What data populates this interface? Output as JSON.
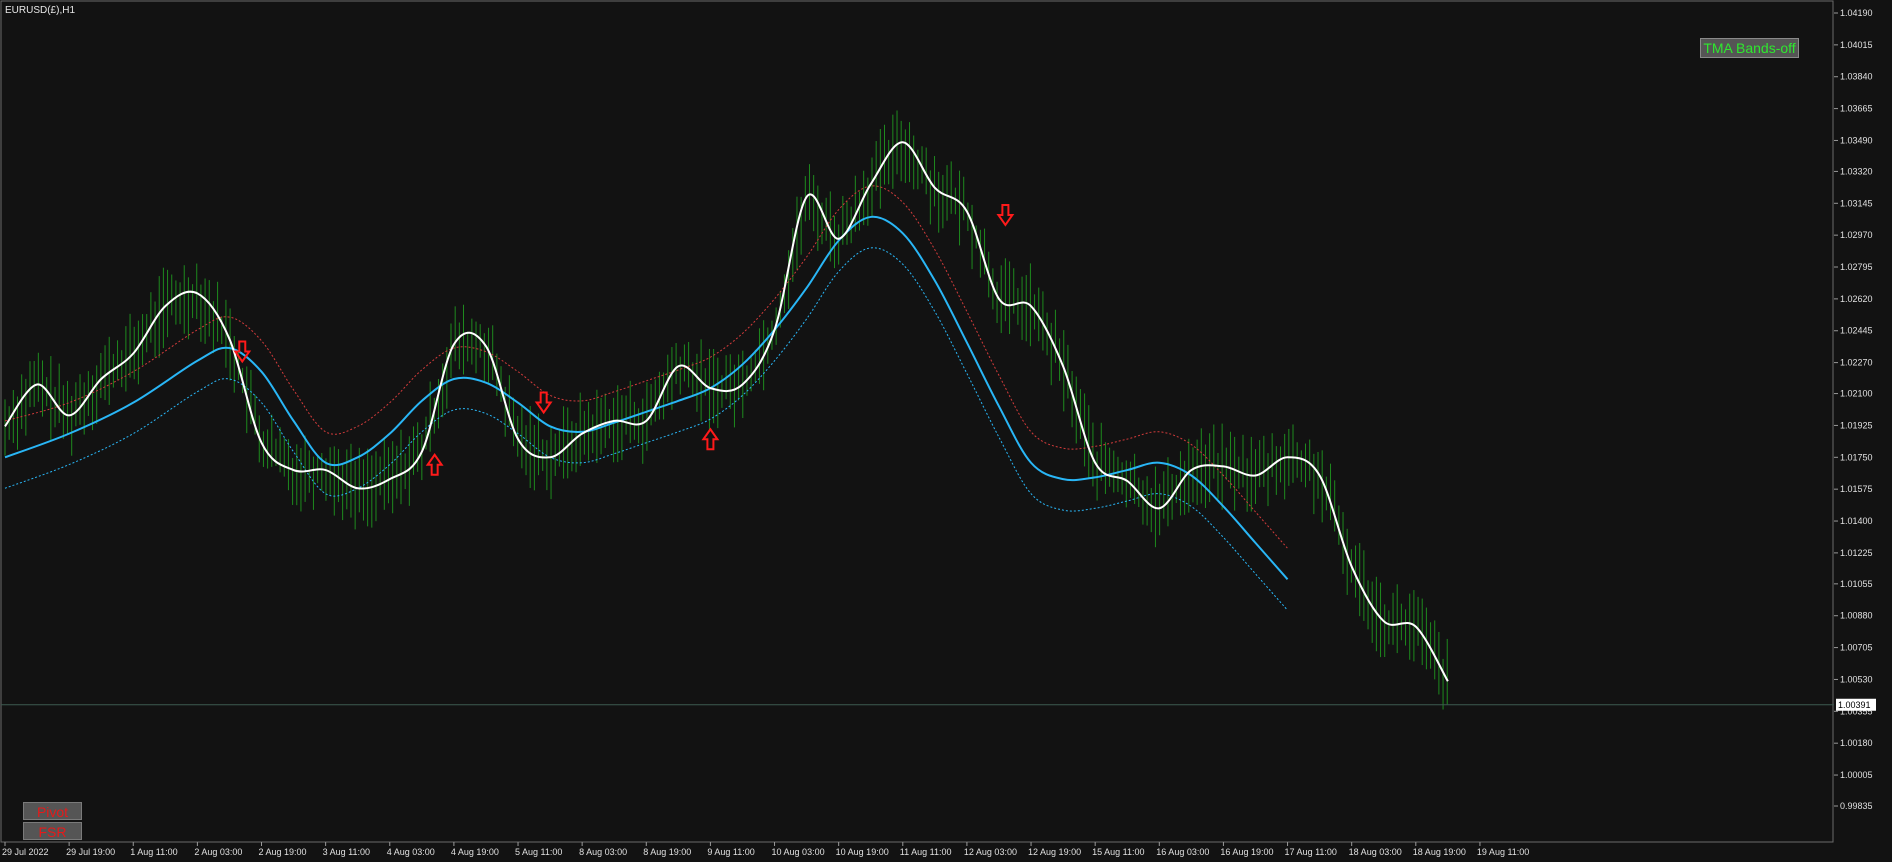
{
  "header": {
    "symbol_label": "EURUSD(£),H1"
  },
  "buttons": {
    "tma": "TMA Bands-off",
    "pivot": "Pivot",
    "fsr": "FSR"
  },
  "colors": {
    "background": "#121212",
    "axis": "#e0e0e0",
    "candles": "#1e8a1e",
    "price_line": "#ffffff",
    "tma_mid": "#29b6f6",
    "tma_mid_down": "#a89ab8",
    "upper_band": "#d23b3b",
    "lower_band": "#29b6f6",
    "signal": "#ff1a1a"
  },
  "chart_data": {
    "type": "line",
    "title": "EURUSD(£),H1",
    "ylim": [
      0.99835,
      1.0419
    ],
    "y_ticks": [
      "1.04190",
      "1.04015",
      "1.03840",
      "1.03665",
      "1.03490",
      "1.03320",
      "1.03145",
      "1.02970",
      "1.02795",
      "1.02620",
      "1.02445",
      "1.02270",
      "1.02100",
      "1.01925",
      "1.01750",
      "1.01575",
      "1.01400",
      "1.01225",
      "1.01055",
      "1.00880",
      "1.00705",
      "1.00530",
      "1.00355",
      "1.00180",
      "1.00005",
      "0.99835"
    ],
    "x_ticks": [
      "29 Jul 2022",
      "29 Jul 19:00",
      "1 Aug 11:00",
      "2 Aug 03:00",
      "2 Aug 19:00",
      "3 Aug 11:00",
      "4 Aug 03:00",
      "4 Aug 19:00",
      "5 Aug 11:00",
      "8 Aug 03:00",
      "8 Aug 19:00",
      "9 Aug 11:00",
      "10 Aug 03:00",
      "10 Aug 19:00",
      "11 Aug 11:00",
      "12 Aug 03:00",
      "12 Aug 19:00",
      "15 Aug 11:00",
      "16 Aug 03:00",
      "16 Aug 19:00",
      "17 Aug 11:00",
      "18 Aug 03:00",
      "18 Aug 19:00",
      "19 Aug 11:00"
    ],
    "current_price": "1.00391",
    "series": [
      {
        "key": "price",
        "x": [
          0,
          0.5,
          1,
          1.5,
          2,
          2.5,
          3,
          3.5,
          4,
          4.5,
          5,
          5.5,
          6,
          6.5,
          7,
          7.5,
          8,
          8.5,
          9,
          9.5,
          10,
          10.5,
          11,
          11.5,
          12,
          12.5,
          13,
          13.5,
          14,
          14.5,
          15,
          15.5,
          16,
          16.5,
          17,
          17.5,
          18,
          18.5,
          19,
          19.5,
          20,
          20.5,
          21,
          21.5,
          22,
          22.5,
          23,
          23.5
        ],
        "values": [
          1.0192,
          1.0215,
          1.0198,
          1.0218,
          1.0232,
          1.0258,
          1.0265,
          1.024,
          1.0183,
          1.0168,
          1.0168,
          1.0158,
          1.0163,
          1.0178,
          1.0237,
          1.0236,
          1.0185,
          1.0175,
          1.0188,
          1.0195,
          1.0195,
          1.0225,
          1.0213,
          1.0215,
          1.0245,
          1.0318,
          1.0295,
          1.0325,
          1.0348,
          1.0323,
          1.031,
          1.0262,
          1.0258,
          1.0225,
          1.0172,
          1.0162,
          1.0147,
          1.0168,
          1.017,
          1.0165,
          1.0175,
          1.0165,
          1.0115,
          1.0085,
          1.0082,
          1.0052,
          null,
          null
        ]
      },
      {
        "key": "tma_mid",
        "x": [
          0,
          1,
          2,
          3,
          3.5,
          4,
          4.5,
          5,
          5.5,
          6,
          6.5,
          7,
          7.5,
          8,
          8.5,
          9,
          9.5,
          10,
          10.5,
          11,
          11.5,
          12,
          12.5,
          13,
          13.5,
          14,
          14.5,
          15,
          15.5,
          16,
          16.5,
          17,
          17.5,
          18,
          18.5,
          19,
          19.5,
          20,
          20.5,
          21,
          21.5,
          22,
          22.5,
          23,
          23.5
        ],
        "values": [
          1.0175,
          1.0188,
          1.0205,
          1.0228,
          1.0235,
          1.0222,
          1.0195,
          1.0172,
          1.0175,
          1.0188,
          1.0206,
          1.0218,
          1.0216,
          1.0205,
          1.0192,
          1.0189,
          1.0194,
          1.02,
          1.0206,
          1.0213,
          1.0226,
          1.0245,
          1.0268,
          1.0294,
          1.0307,
          1.0298,
          1.0272,
          1.0238,
          1.0203,
          1.0172,
          1.0163,
          1.0164,
          1.0168,
          1.0172,
          1.0165,
          1.0148,
          1.0128,
          1.0108,
          null,
          null,
          null,
          null,
          null,
          null,
          null
        ]
      },
      {
        "key": "upper_band",
        "x": [
          0,
          1,
          2,
          3,
          3.5,
          4,
          4.5,
          5,
          5.5,
          6,
          6.5,
          7,
          7.5,
          8,
          8.5,
          9,
          9.5,
          10,
          10.5,
          11,
          11.5,
          12,
          12.5,
          13,
          13.5,
          14,
          14.5,
          15,
          15.5,
          16,
          16.5,
          17,
          17.5,
          18,
          18.5,
          19,
          19.5,
          20,
          20.5,
          21,
          21.5,
          22,
          22.5,
          23,
          23.5
        ],
        "values": [
          1.0195,
          1.0205,
          1.0222,
          1.0245,
          1.0252,
          1.0239,
          1.0212,
          1.0189,
          1.0192,
          1.0205,
          1.0223,
          1.0235,
          1.0233,
          1.0222,
          1.0209,
          1.0206,
          1.0211,
          1.0217,
          1.0223,
          1.023,
          1.0243,
          1.0262,
          1.0285,
          1.0311,
          1.0324,
          1.0315,
          1.0289,
          1.0255,
          1.022,
          1.0189,
          1.018,
          1.0181,
          1.0185,
          1.0189,
          1.0182,
          1.0165,
          1.0145,
          1.0125,
          null,
          null,
          null,
          null,
          null,
          null,
          null
        ]
      },
      {
        "key": "lower_band",
        "x": [
          0,
          1,
          2,
          3,
          3.5,
          4,
          4.5,
          5,
          5.5,
          6,
          6.5,
          7,
          7.5,
          8,
          8.5,
          9,
          9.5,
          10,
          10.5,
          11,
          11.5,
          12,
          12.5,
          13,
          13.5,
          14,
          14.5,
          15,
          15.5,
          16,
          16.5,
          17,
          17.5,
          18,
          18.5,
          19,
          19.5,
          20,
          20.5,
          21,
          21.5,
          22,
          22.5,
          23,
          23.5
        ],
        "values": [
          1.0158,
          1.0171,
          1.0188,
          1.0211,
          1.0218,
          1.0205,
          1.0178,
          1.0155,
          1.0158,
          1.0171,
          1.0189,
          1.0201,
          1.0199,
          1.0188,
          1.0175,
          1.0172,
          1.0177,
          1.0183,
          1.0189,
          1.0196,
          1.0209,
          1.0228,
          1.0251,
          1.0277,
          1.029,
          1.0281,
          1.0255,
          1.0221,
          1.0186,
          1.0155,
          1.0146,
          1.0147,
          1.0151,
          1.0155,
          1.0148,
          1.0131,
          1.0111,
          1.0091,
          null,
          null,
          null,
          null,
          null,
          null,
          null
        ]
      }
    ],
    "signals": [
      {
        "x": 3.7,
        "direction": "down",
        "price": 1.0232
      },
      {
        "x": 6.7,
        "direction": "up",
        "price": 1.0172
      },
      {
        "x": 8.4,
        "direction": "down",
        "price": 1.0204
      },
      {
        "x": 11.0,
        "direction": "up",
        "price": 1.0186
      },
      {
        "x": 15.6,
        "direction": "down",
        "price": 1.0307
      }
    ]
  }
}
